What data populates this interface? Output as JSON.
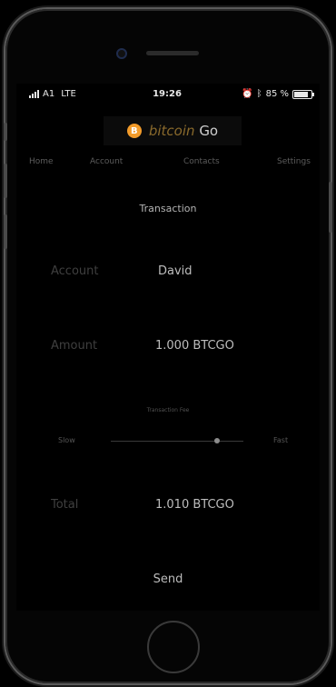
{
  "status_bar": {
    "carrier": "A1",
    "network": "LTE",
    "time": "19:26",
    "battery_text": "85 %",
    "battery_level": 0.85
  },
  "logo": {
    "icon_glyph": "B",
    "word_a": "bitcoin",
    "word_b": "Go"
  },
  "nav": {
    "items": [
      "Home",
      "Account",
      "Contacts",
      "Settings"
    ]
  },
  "page": {
    "title": "Transaction"
  },
  "form": {
    "account_label": "Account",
    "account_value": "David",
    "amount_label": "Amount",
    "amount_value": "1.000 BTCGO",
    "fee_label": "Transaction Fee",
    "fee_slow": "Slow",
    "fee_fast": "Fast",
    "fee_level": 0.8,
    "total_label": "Total",
    "total_value": "1.010 BTCGO",
    "send_label": "Send"
  },
  "colors": {
    "accent_coin": "#f29b2a",
    "background": "#000000"
  }
}
